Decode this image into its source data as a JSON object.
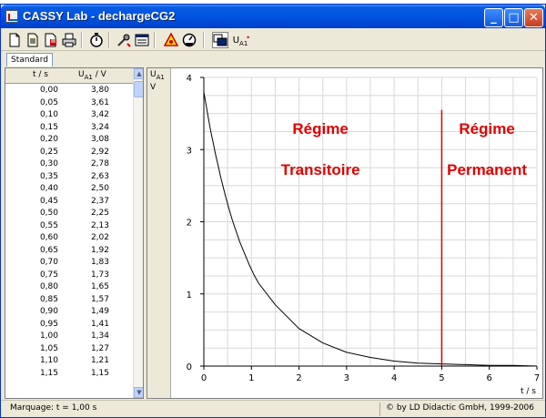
{
  "window": {
    "title": "CASSY Lab - dechargeCG2"
  },
  "window_buttons": {
    "minimize": "_",
    "maximize": "□",
    "close": "✕"
  },
  "toolbar": {
    "icons": [
      "new-file-icon",
      "open-file-icon",
      "save-file-icon",
      "print-icon",
      "stopwatch-icon",
      "settings-icon",
      "table-icon",
      "alarm-icon",
      "gauge-icon",
      "display-icon"
    ],
    "ua1_label": "U",
    "ua1_sub": "A1"
  },
  "tabs": [
    {
      "label": "Standard"
    }
  ],
  "table": {
    "col_t": "t / s",
    "col_u": "U",
    "col_u_sub": "A1",
    "col_u_unit": " / V",
    "rows": [
      [
        "0,00",
        "3,80"
      ],
      [
        "0,05",
        "3,61"
      ],
      [
        "0,10",
        "3,42"
      ],
      [
        "0,15",
        "3,24"
      ],
      [
        "0,20",
        "3,08"
      ],
      [
        "0,25",
        "2,92"
      ],
      [
        "0,30",
        "2,78"
      ],
      [
        "0,35",
        "2,63"
      ],
      [
        "0,40",
        "2,50"
      ],
      [
        "0,45",
        "2,37"
      ],
      [
        "0,50",
        "2,25"
      ],
      [
        "0,55",
        "2,13"
      ],
      [
        "0,60",
        "2,02"
      ],
      [
        "0,65",
        "1,92"
      ],
      [
        "0,70",
        "1,83"
      ],
      [
        "0,75",
        "1,73"
      ],
      [
        "0,80",
        "1,65"
      ],
      [
        "0,85",
        "1,57"
      ],
      [
        "0,90",
        "1,49"
      ],
      [
        "0,95",
        "1,41"
      ],
      [
        "1,00",
        "1,34"
      ],
      [
        "1,05",
        "1,27"
      ],
      [
        "1,10",
        "1,21"
      ],
      [
        "1,15",
        "1,15"
      ]
    ]
  },
  "chart": {
    "ylabel_u": "U",
    "ylabel_sub": "A1",
    "ylabel_unit": "V",
    "xlabel": "t / s",
    "label_transitoire_1": "Régime",
    "label_transitoire_2": "Transitoire",
    "label_permanent_1": "Régime",
    "label_permanent_2": "Permanent",
    "annotation_color": "#e00000",
    "curve_color": "#000000",
    "grid_color": "#d8d8d8"
  },
  "chart_data": {
    "type": "line",
    "title": "",
    "xlabel": "t / s",
    "ylabel": "U A1 / V",
    "xlim": [
      0,
      7
    ],
    "ylim": [
      0,
      4
    ],
    "x_ticks": [
      "0",
      "1",
      "2",
      "3",
      "4",
      "5",
      "6",
      "7"
    ],
    "y_ticks": [
      "0",
      "1",
      "2",
      "3",
      "4"
    ],
    "grid": true,
    "series": [
      {
        "name": "",
        "x": [
          0,
          0.05,
          0.1,
          0.15,
          0.2,
          0.25,
          0.3,
          0.35,
          0.4,
          0.45,
          0.5,
          0.55,
          0.6,
          0.65,
          0.7,
          0.75,
          0.8,
          0.85,
          0.9,
          0.95,
          1.0,
          1.05,
          1.1,
          1.15,
          1.5,
          2.0,
          2.5,
          3.0,
          3.5,
          4.0,
          4.5,
          5.0,
          5.5,
          6.0,
          6.5,
          7.0
        ],
        "y": [
          3.8,
          3.61,
          3.42,
          3.24,
          3.08,
          2.92,
          2.78,
          2.63,
          2.5,
          2.37,
          2.25,
          2.13,
          2.02,
          1.92,
          1.83,
          1.73,
          1.65,
          1.57,
          1.49,
          1.41,
          1.34,
          1.27,
          1.21,
          1.15,
          0.85,
          0.52,
          0.32,
          0.19,
          0.12,
          0.07,
          0.04,
          0.03,
          0.02,
          0.01,
          0.01,
          0.0
        ]
      }
    ],
    "marker_line_x": 5,
    "marker_line_top": 3.55,
    "annotations": [
      "Régime Transitoire",
      "Régime Permanent"
    ]
  },
  "status": {
    "left": "Marquage:  t = 1,00 s",
    "right": "© by LD Didactic GmbH, 1999-2006"
  }
}
